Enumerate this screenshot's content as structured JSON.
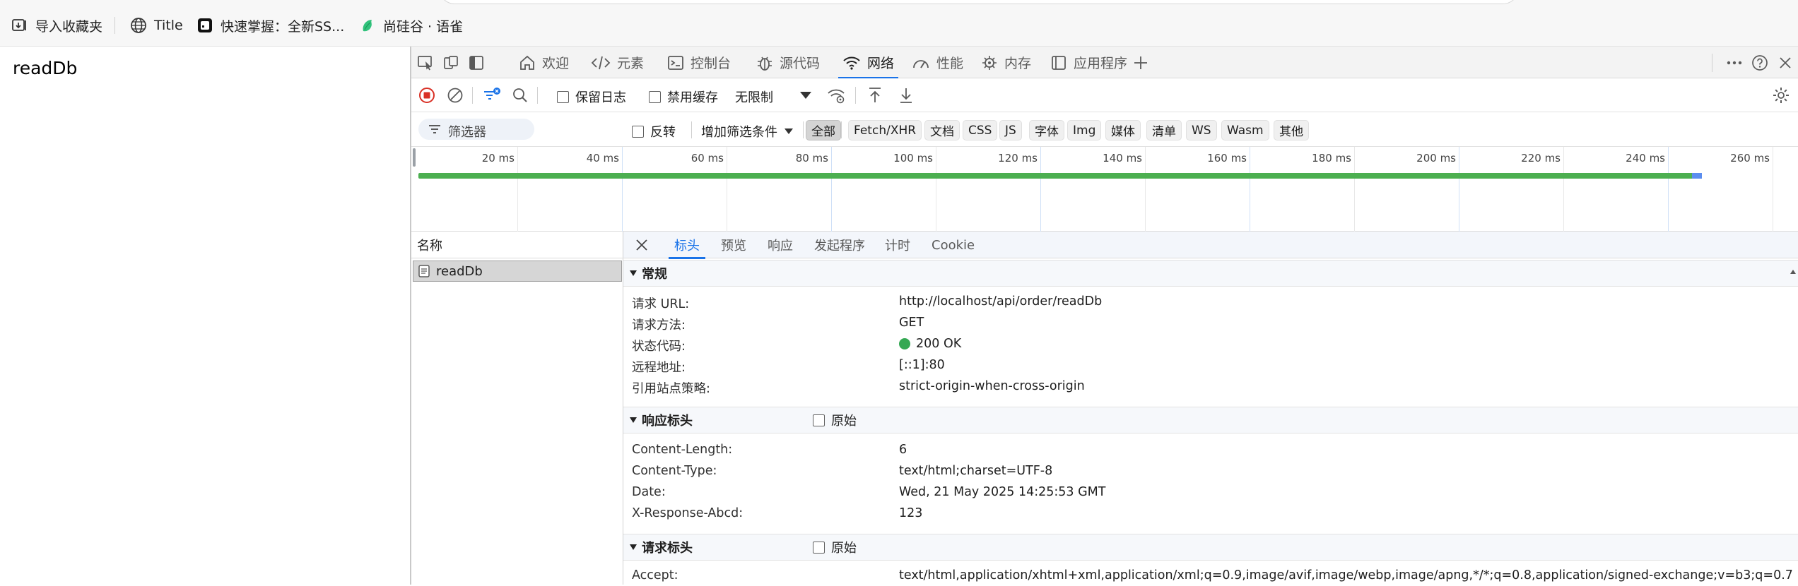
{
  "bookmarks": {
    "items": [
      {
        "label": "导入收藏夹",
        "icon": "import-favorites-icon"
      },
      {
        "label": "Title",
        "icon": "globe-icon"
      },
      {
        "label": "快速掌握：全新SS...",
        "icon": "app-icon"
      },
      {
        "label": "尚硅谷 · 语雀",
        "icon": "yuque-icon"
      }
    ]
  },
  "page": {
    "text": "readDb"
  },
  "devtools": {
    "tabs": [
      {
        "label": "欢迎",
        "icon": "home-icon"
      },
      {
        "label": "元素",
        "icon": "code-icon"
      },
      {
        "label": "控制台",
        "icon": "console-icon"
      },
      {
        "label": "源代码",
        "icon": "bug-icon"
      },
      {
        "label": "网络",
        "icon": "wifi-icon",
        "active": true
      },
      {
        "label": "性能",
        "icon": "gauge-icon"
      },
      {
        "label": "内存",
        "icon": "memory-icon"
      },
      {
        "label": "应用程序",
        "icon": "application-icon"
      }
    ],
    "toolbar": {
      "preserve_log": "保留日志",
      "disable_cache": "禁用缓存",
      "throttling": "无限制"
    },
    "filter": {
      "placeholder": "筛选器",
      "invert": "反转",
      "more_filters": "增加筛选条件",
      "types": [
        "全部",
        "Fetch/XHR",
        "文档",
        "CSS",
        "JS",
        "字体",
        "Img",
        "媒体",
        "清单",
        "WS",
        "Wasm",
        "其他"
      ],
      "active_type": "全部"
    },
    "overview": {
      "ticks": [
        "20 ms",
        "40 ms",
        "60 ms",
        "80 ms",
        "100 ms",
        "120 ms",
        "140 ms",
        "160 ms",
        "180 ms",
        "200 ms",
        "220 ms",
        "240 ms",
        "260 ms"
      ]
    },
    "requests": {
      "column": "名称",
      "items": [
        {
          "name": "readDb"
        }
      ]
    },
    "details": {
      "tabs": [
        "标头",
        "预览",
        "响应",
        "发起程序",
        "计时",
        "Cookie"
      ],
      "active_tab": "标头",
      "general": {
        "title": "常规",
        "rows": [
          {
            "k": "请求 URL:",
            "v": "http://localhost/api/order/readDb"
          },
          {
            "k": "请求方法:",
            "v": "GET"
          },
          {
            "k": "状态代码:",
            "v": "200 OK"
          },
          {
            "k": "远程地址:",
            "v": "[::1]:80"
          },
          {
            "k": "引用站点策略:",
            "v": "strict-origin-when-cross-origin"
          }
        ]
      },
      "response_headers": {
        "title": "响应标头",
        "raw_label": "原始",
        "rows": [
          {
            "k": "Content-Length:",
            "v": "6"
          },
          {
            "k": "Content-Type:",
            "v": "text/html;charset=UTF-8"
          },
          {
            "k": "Date:",
            "v": "Wed, 21 May 2025 14:25:53 GMT"
          },
          {
            "k": "X-Response-Abcd:",
            "v": "123"
          }
        ]
      },
      "request_headers": {
        "title": "请求标头",
        "raw_label": "原始",
        "rows": [
          {
            "k": "Accept:",
            "v": "text/html,application/xhtml+xml,application/xml;q=0.9,image/avif,image/webp,image/apng,*/*;q=0.8,application/signed-exchange;v=b3;q=0.7"
          }
        ]
      }
    }
  }
}
